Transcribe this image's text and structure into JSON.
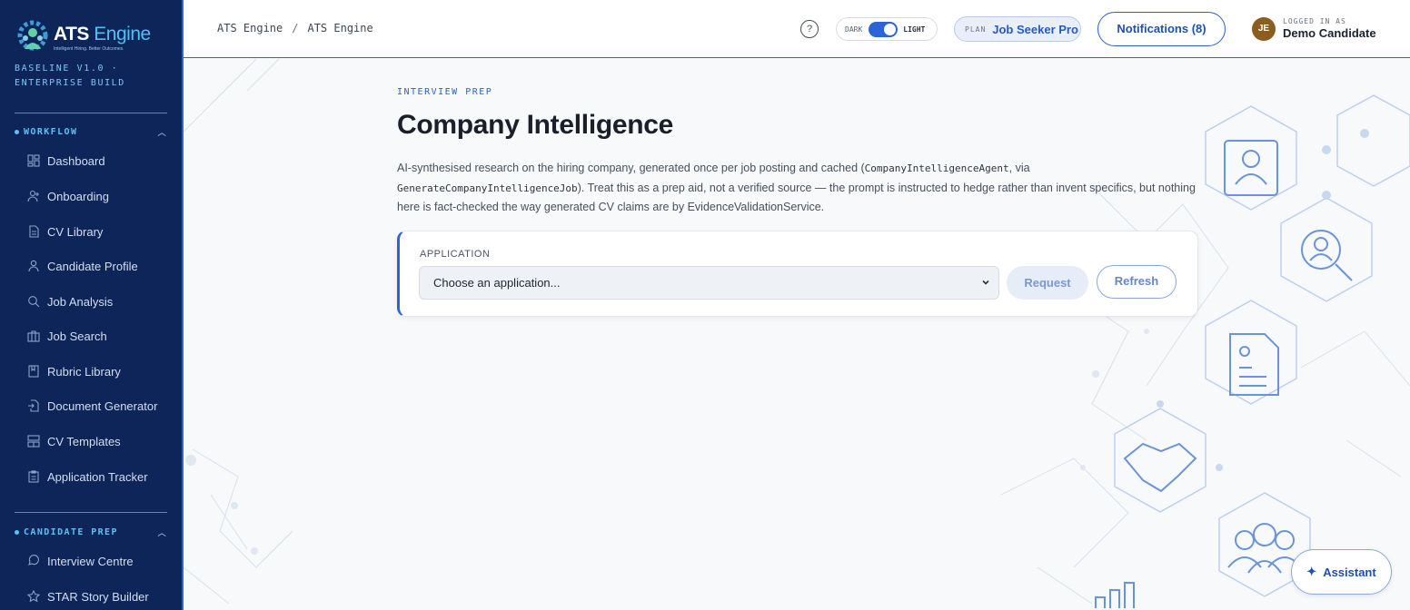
{
  "brand": {
    "name_main": "ATS",
    "name_accent": "Engine",
    "tagline": "Intelligent Hiring. Better Outcomes.",
    "build_line1": "BASELINE V1.0 ·",
    "build_line2": "ENTERPRISE BUILD"
  },
  "sidebar": {
    "sections": [
      {
        "title": "WORKFLOW",
        "items": [
          {
            "label": "Dashboard",
            "icon": "grid-icon"
          },
          {
            "label": "Onboarding",
            "icon": "user-plus-icon"
          },
          {
            "label": "CV Library",
            "icon": "file-icon"
          },
          {
            "label": "Candidate Profile",
            "icon": "user-icon"
          },
          {
            "label": "Job Analysis",
            "icon": "search-icon"
          },
          {
            "label": "Job Search",
            "icon": "briefcase-icon"
          },
          {
            "label": "Rubric Library",
            "icon": "bookmark-icon"
          },
          {
            "label": "Document Generator",
            "icon": "file-export-icon"
          },
          {
            "label": "CV Templates",
            "icon": "layout-icon"
          },
          {
            "label": "Application Tracker",
            "icon": "clipboard-icon"
          }
        ]
      },
      {
        "title": "CANDIDATE PREP",
        "items": [
          {
            "label": "Interview Centre",
            "icon": "chat-icon"
          },
          {
            "label": "STAR Story Builder",
            "icon": "star-icon"
          }
        ]
      }
    ]
  },
  "header": {
    "breadcrumb": [
      "ATS Engine",
      "ATS Engine"
    ],
    "breadcrumb_sep": "/",
    "help": "?",
    "theme_dark": "DARK",
    "theme_light": "LIGHT",
    "theme_mode": "light",
    "plan_label": "PLAN",
    "plan_value": "Job Seeker Pro",
    "notifications": "Notifications (8)",
    "avatar_initials": "JE",
    "logged_in_label": "LOGGED IN AS",
    "user_name": "Demo Candidate"
  },
  "main": {
    "eyebrow": "INTERVIEW PREP",
    "title": "Company Intelligence",
    "desc_1": "AI-synthesised research on the hiring company, generated once per job posting and cached (",
    "desc_code_1": "CompanyIntelligenceAgent",
    "desc_2": ", via",
    "desc_code_2": "GenerateCompanyIntelligenceJob",
    "desc_3": "). Treat this as a prep aid, not a verified source — the prompt is instructed to hedge rather than invent specifics, but nothing here is fact-checked the way generated CV claims are by EvidenceValidationService.",
    "form": {
      "label": "APPLICATION",
      "select_value": "Choose an application...",
      "request_label": "Request",
      "refresh_label": "Refresh"
    }
  },
  "assistant_label": "Assistant",
  "colors": {
    "sidebar_bg": "#0d2558",
    "accent": "#2c63d6",
    "brand_accent": "#4cc3f5"
  }
}
